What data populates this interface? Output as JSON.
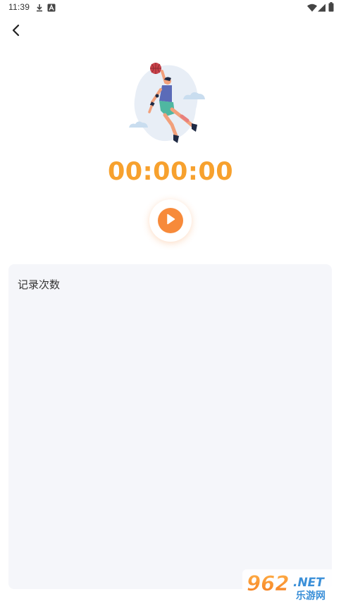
{
  "status_bar": {
    "time": "11:39",
    "icons": [
      "download-icon",
      "a-badge-icon",
      "wifi-icon",
      "signal-icon",
      "battery-icon"
    ]
  },
  "nav": {
    "back_icon": "chevron-left-icon"
  },
  "timer": {
    "display": "00:00:00",
    "color": "#F7A12E"
  },
  "play_button": {
    "icon": "play-icon",
    "color": "#F78A3A"
  },
  "records": {
    "title": "记录次数",
    "items": []
  },
  "watermark": {
    "brand_number": "962",
    "brand_suffix": ".NET",
    "brand_cn": "乐游网"
  }
}
